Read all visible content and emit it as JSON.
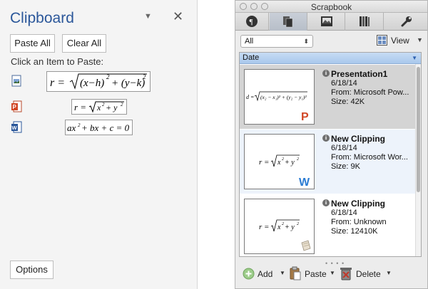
{
  "clipboard": {
    "title": "Clipboard",
    "paste_all": "Paste All",
    "clear_all": "Clear All",
    "instruction": "Click an Item to Paste:",
    "items": [
      {
        "icon": "image-clip-icon",
        "preview": "r = √((x−h)² + (y−k)²)"
      },
      {
        "icon": "powerpoint-clip-icon",
        "preview": "r = √(x² + y²)"
      },
      {
        "icon": "word-clip-icon",
        "preview": "ax² + bx + c = 0"
      }
    ],
    "options": "Options"
  },
  "scrapbook": {
    "title": "Scrapbook",
    "tabs": [
      "clippings-tab",
      "multiple-tab",
      "images-tab",
      "library-tab",
      "tools-tab"
    ],
    "filter": "All",
    "view_label": "View",
    "column_header": "Date",
    "items": [
      {
        "name": "Presentation1",
        "date": "6/18/14",
        "from": "From: Microsoft Pow...",
        "size": "Size: 42K",
        "badge": "powerpoint-icon",
        "formula": "d = √((x₂ − x₁)² + (y₂ − y₁)²)",
        "selected": true
      },
      {
        "name": "New Clipping",
        "date": "6/18/14",
        "from": "From: Microsoft Wor...",
        "size": "Size: 9K",
        "badge": "word-icon",
        "formula": "r = √(x² + y²)",
        "selected": false
      },
      {
        "name": "New Clipping",
        "date": "6/18/14",
        "from": "From: Unknown",
        "size": "Size: 12410K",
        "badge": "clipping-icon",
        "formula": "r = √(x² + y²)",
        "selected": false
      }
    ],
    "bottom": {
      "add": "Add",
      "paste": "Paste",
      "delete": "Delete"
    }
  },
  "colors": {
    "word_blue": "#2b579a",
    "selected_row": "#d4d4d4",
    "accent_header": "#a9c8ec"
  }
}
